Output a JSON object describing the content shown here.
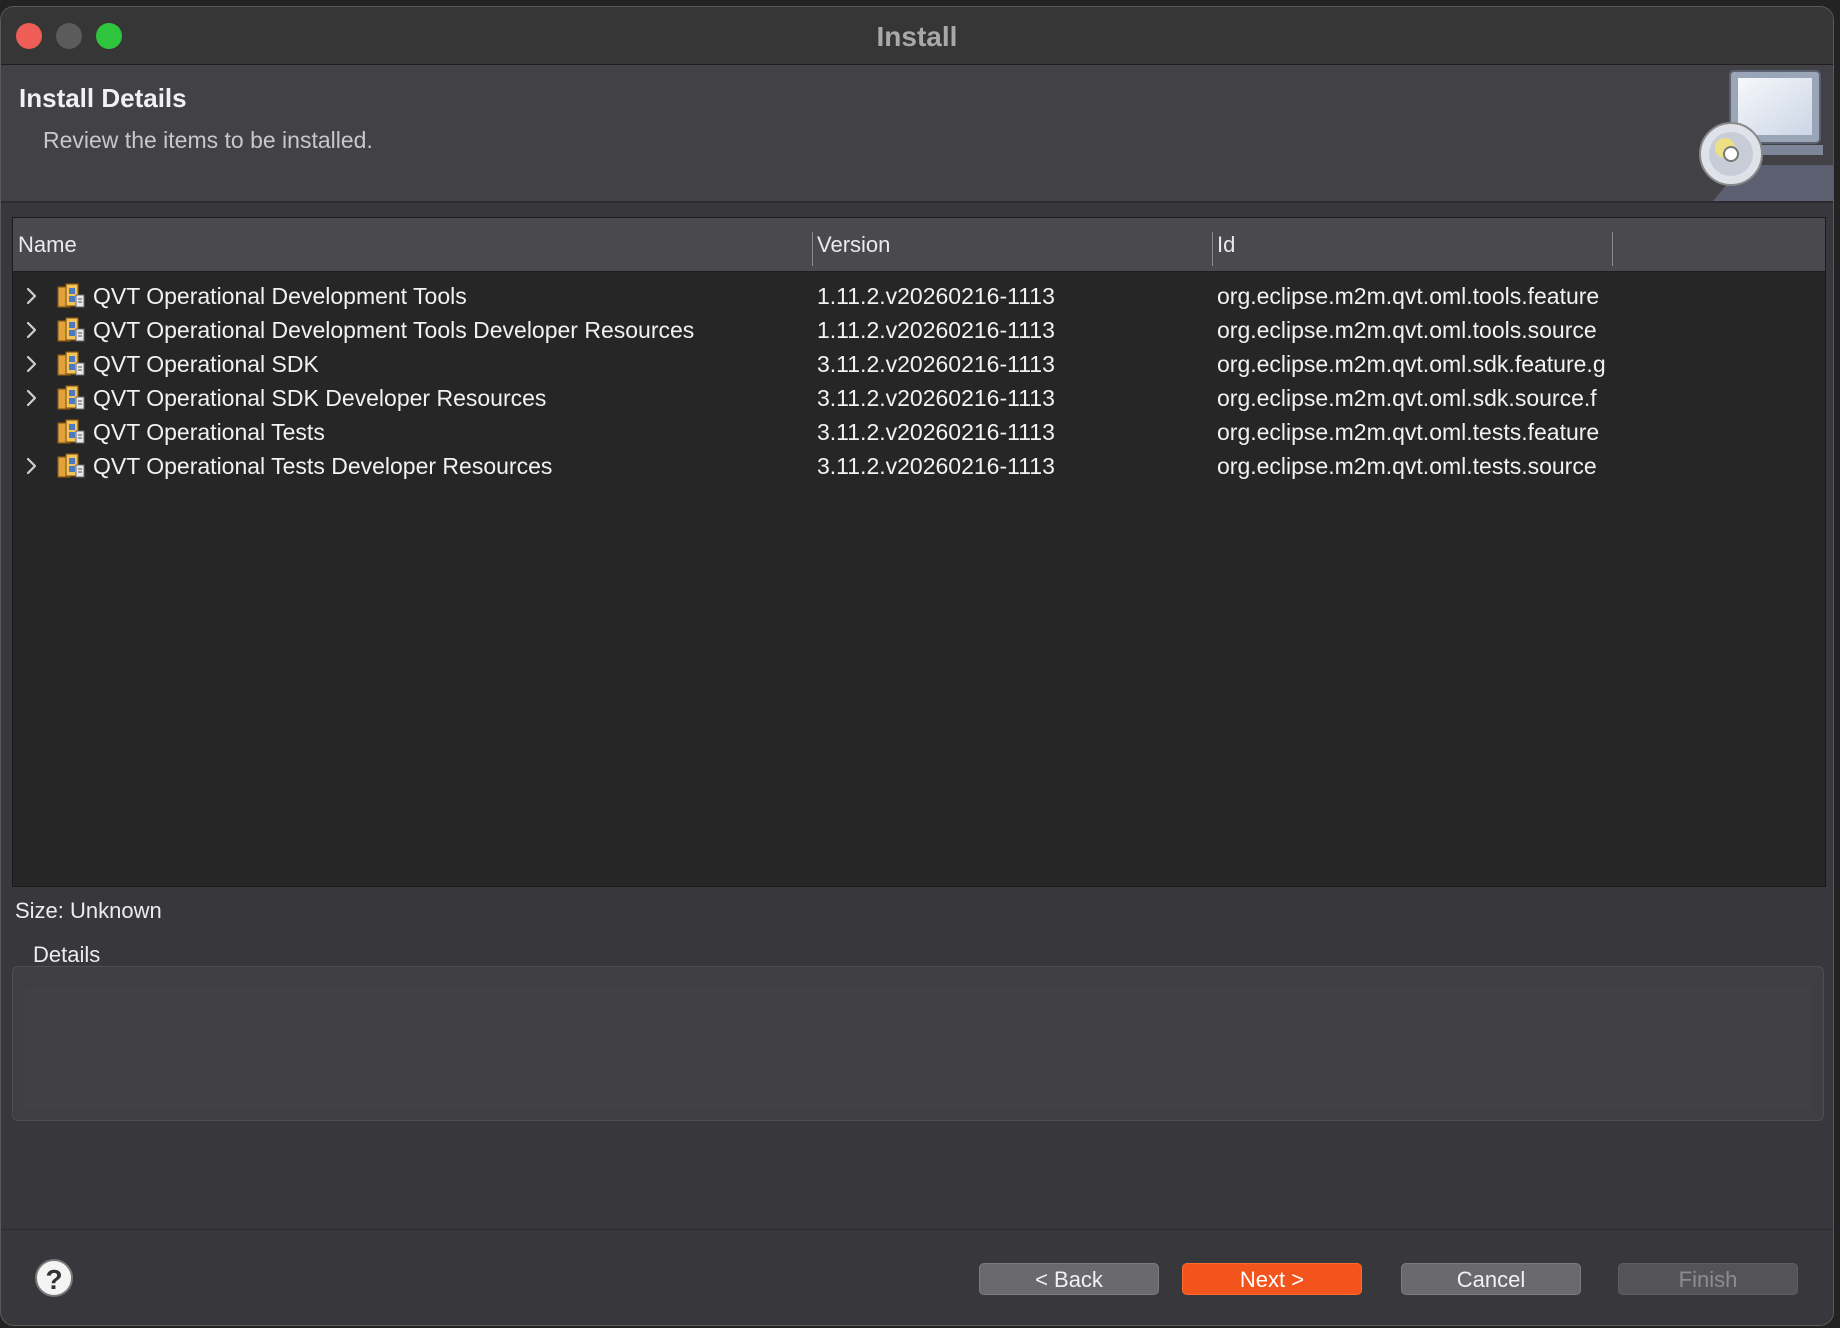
{
  "window": {
    "title": "Install"
  },
  "banner": {
    "title": "Install Details",
    "description": "Review the items to be installed."
  },
  "table": {
    "columns": {
      "name": "Name",
      "version": "Version",
      "id": "Id"
    },
    "rows": [
      {
        "expandable": true,
        "name": "QVT Operational Development Tools",
        "version": "1.11.2.v20260216-1113",
        "id": "org.eclipse.m2m.qvt.oml.tools.feature"
      },
      {
        "expandable": true,
        "name": "QVT Operational Development Tools Developer Resources",
        "version": "1.11.2.v20260216-1113",
        "id": "org.eclipse.m2m.qvt.oml.tools.source"
      },
      {
        "expandable": true,
        "name": "QVT Operational SDK",
        "version": "3.11.2.v20260216-1113",
        "id": "org.eclipse.m2m.qvt.oml.sdk.feature.g"
      },
      {
        "expandable": true,
        "name": "QVT Operational SDK Developer Resources",
        "version": "3.11.2.v20260216-1113",
        "id": "org.eclipse.m2m.qvt.oml.sdk.source.f"
      },
      {
        "expandable": false,
        "name": "QVT Operational Tests",
        "version": "3.11.2.v20260216-1113",
        "id": "org.eclipse.m2m.qvt.oml.tests.feature"
      },
      {
        "expandable": true,
        "name": "QVT Operational Tests Developer Resources",
        "version": "3.11.2.v20260216-1113",
        "id": "org.eclipse.m2m.qvt.oml.tests.source"
      }
    ]
  },
  "size": {
    "label": "Size: Unknown"
  },
  "details": {
    "label": "Details"
  },
  "footer": {
    "help": "?",
    "back": "< Back",
    "next": "Next >",
    "cancel": "Cancel",
    "finish": "Finish"
  },
  "colors": {
    "accent": "#f2541b",
    "window_bg": "#38383c",
    "table_bg": "#262626"
  }
}
